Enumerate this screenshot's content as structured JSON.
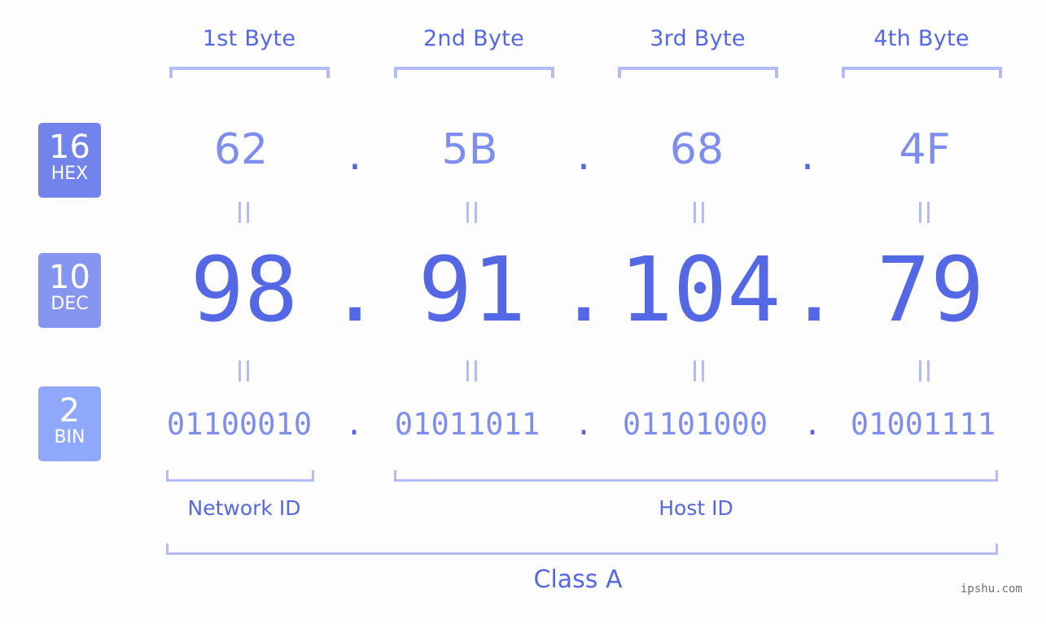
{
  "bytes": [
    {
      "label": "1st Byte",
      "hex": "62",
      "dec": "98",
      "bin": "01100010"
    },
    {
      "label": "2nd Byte",
      "hex": "5B",
      "dec": "91",
      "bin": "01011011"
    },
    {
      "label": "3rd Byte",
      "hex": "68",
      "dec": "104",
      "bin": "01101000"
    },
    {
      "label": "4th Byte",
      "hex": "4F",
      "dec": "79",
      "bin": "01001111"
    }
  ],
  "separator": ".",
  "badges": {
    "hex": {
      "num": "16",
      "label": "HEX"
    },
    "dec": {
      "num": "10",
      "label": "DEC"
    },
    "bin": {
      "num": "2",
      "label": "BIN"
    }
  },
  "segments": {
    "network": "Network ID",
    "host": "Host ID",
    "class": "Class A"
  },
  "watermark": "ipshu.com",
  "colors": {
    "accent": "#5468e6",
    "light_accent": "#7d8df0",
    "bracket": "#b3bcf8",
    "hex_badge": "#7383ec",
    "dec_badge": "#8595f0",
    "bin_badge": "#90a8fb"
  }
}
